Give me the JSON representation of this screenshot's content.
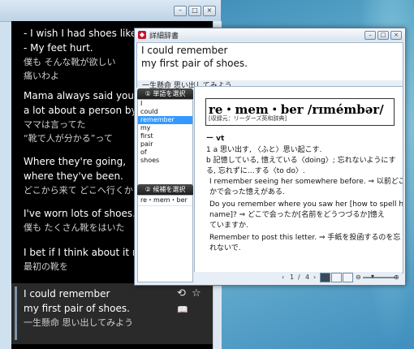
{
  "lyrics_window": {
    "lines": [
      {
        "en1": "- I wish I had shoes like tha",
        "en2": "- My feet hurt.",
        "jp1": "僕も そんな靴が欲しい",
        "jp2": "痛いわよ"
      },
      {
        "en1": "Mama always said you can",
        "en2": "a lot about a person by the",
        "jp1": "ママは言ってた",
        "jp2": "“靴で人が分かる”って"
      },
      {
        "en1": "Where they're going,",
        "en2": "where they've been.",
        "jp1": "どこから来て どこへ行くか",
        "jp2": ""
      },
      {
        "en1": "I've worn lots of shoes.",
        "en2": "",
        "jp1": "僕も たくさん靴をはいた",
        "jp2": ""
      },
      {
        "en1": "I bet if I think about it real",
        "en2": "",
        "jp1": "最初の靴を",
        "jp2": ""
      }
    ],
    "current": {
      "en1": "I could remember",
      "en2": "my first pair of shoes.",
      "jp": "一生懸命 思い出してみよう"
    },
    "icons": {
      "replay": "replay-icon",
      "star": "star-icon",
      "book": "dictionary-icon"
    }
  },
  "dictionary": {
    "title": "詳細辞書",
    "source_line1": "I could remember",
    "source_line2": "my first pair of shoes.",
    "source_jp": "一生懸命 思い出してみよう",
    "word_panel_label": "① 単語を選択",
    "words": [
      "I",
      "could",
      "remember",
      "my",
      "first",
      "pair",
      "of",
      "shoes"
    ],
    "selected_word": "remember",
    "candidate_panel_label": "② 候補を選択",
    "candidates": [
      "re・mem・ber"
    ],
    "headword": "re・mem・ber /rɪmémbər/",
    "headword_source": "[収録元：リーダーズ英和辞典]",
    "pos": "ー vt",
    "entries": [
      "1 a 思い出す, 〈ふと〉思い起こす.",
      "b 記憶している, 憶えている〈doing〉; 忘れないようにす",
      "る, 忘れずに…する〈to do〉.",
      "I remember seeing her somewhere before.  ⇒ 以前どこ",
      "かで会った憶えがある.",
      "Do you remember where you saw her [how to spell her",
      "name]?  ⇒  どこで会ったか[名前をどうつづるか]憶え",
      "ていますか.",
      "Remember to post this letter.  ⇒ 手紙を投函するのを忘",
      "れないで."
    ],
    "page_current": "1",
    "page_separator": "/",
    "page_total": "4",
    "prev_label": "‹",
    "next_label": "›"
  }
}
